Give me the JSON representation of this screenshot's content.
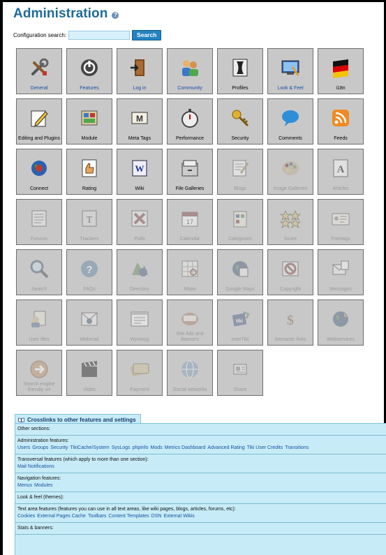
{
  "page": {
    "title": "Administration",
    "search_label": "Configuration search:",
    "search_value": "",
    "search_button": "Search"
  },
  "features": [
    {
      "label": "General",
      "icon": "tools-icon",
      "enabled": true,
      "link": true
    },
    {
      "label": "Features",
      "icon": "power-icon",
      "enabled": true,
      "link": true
    },
    {
      "label": "Log in",
      "icon": "login-door-icon",
      "enabled": true,
      "link": true
    },
    {
      "label": "Community",
      "icon": "community-icon",
      "enabled": true,
      "link": true
    },
    {
      "label": "Profiles",
      "icon": "profiles-icon",
      "enabled": true,
      "link": false
    },
    {
      "label": "Look & Feel",
      "icon": "look-feel-icon",
      "enabled": true,
      "link": true
    },
    {
      "label": "i18n",
      "icon": "flag-icon",
      "enabled": true,
      "link": false
    },
    {
      "label": "Editing and Plugins",
      "icon": "edit-pencil-icon",
      "enabled": true,
      "link": false
    },
    {
      "label": "Module",
      "icon": "module-icon",
      "enabled": true,
      "link": false
    },
    {
      "label": "Meta Tags",
      "icon": "meta-tags-icon",
      "enabled": true,
      "link": false
    },
    {
      "label": "Performance",
      "icon": "stopwatch-icon",
      "enabled": true,
      "link": false
    },
    {
      "label": "Security",
      "icon": "key-icon",
      "enabled": true,
      "link": false
    },
    {
      "label": "Comments",
      "icon": "comment-bubble-icon",
      "enabled": true,
      "link": false
    },
    {
      "label": "Feeds",
      "icon": "rss-icon",
      "enabled": true,
      "link": false
    },
    {
      "label": "Connect",
      "icon": "connect-globe-icon",
      "enabled": true,
      "link": false
    },
    {
      "label": "Rating",
      "icon": "rating-thumb-icon",
      "enabled": true,
      "link": false
    },
    {
      "label": "Wiki",
      "icon": "wiki-icon",
      "enabled": true,
      "link": false
    },
    {
      "label": "File Galleries",
      "icon": "file-cabinet-icon",
      "enabled": true,
      "link": false
    },
    {
      "label": "Blogs",
      "icon": "blog-icon",
      "enabled": false,
      "link": false
    },
    {
      "label": "Image Galleries",
      "icon": "palette-icon",
      "enabled": false,
      "link": false
    },
    {
      "label": "Articles",
      "icon": "articles-icon",
      "enabled": false,
      "link": false
    },
    {
      "label": "Forums",
      "icon": "forums-icon",
      "enabled": false,
      "link": false
    },
    {
      "label": "Trackers",
      "icon": "trackers-icon",
      "enabled": false,
      "link": false
    },
    {
      "label": "Polls",
      "icon": "polls-icon",
      "enabled": false,
      "link": false
    },
    {
      "label": "Calendar",
      "icon": "calendar-icon",
      "enabled": false,
      "link": false
    },
    {
      "label": "Categories",
      "icon": "categories-icon",
      "enabled": false,
      "link": false
    },
    {
      "label": "Score",
      "icon": "stars-icon",
      "enabled": false,
      "link": false
    },
    {
      "label": "Freetags",
      "icon": "freetags-icon",
      "enabled": false,
      "link": false
    },
    {
      "label": "Search",
      "icon": "magnifier-icon",
      "enabled": false,
      "link": false
    },
    {
      "label": "FAQs",
      "icon": "faq-icon",
      "enabled": false,
      "link": false
    },
    {
      "label": "Directory",
      "icon": "directory-icon",
      "enabled": false,
      "link": false
    },
    {
      "label": "Maps",
      "icon": "maps-icon",
      "enabled": false,
      "link": false
    },
    {
      "label": "Google Maps",
      "icon": "google-maps-icon",
      "enabled": false,
      "link": false
    },
    {
      "label": "Copyright",
      "icon": "copyright-icon",
      "enabled": false,
      "link": false
    },
    {
      "label": "Messages",
      "icon": "messages-icon",
      "enabled": false,
      "link": false
    },
    {
      "label": "User files",
      "icon": "user-files-icon",
      "enabled": false,
      "link": false
    },
    {
      "label": "Webmail",
      "icon": "webmail-icon",
      "enabled": false,
      "link": false
    },
    {
      "label": "Wysiwyg",
      "icon": "wysiwyg-icon",
      "enabled": false,
      "link": false
    },
    {
      "label": "Site Ads and Banners",
      "icon": "site-ads-icon",
      "enabled": false,
      "link": false
    },
    {
      "label": "InterTiki",
      "icon": "intertiki-icon",
      "enabled": false,
      "link": false
    },
    {
      "label": "Semantic links",
      "icon": "semantic-links-icon",
      "enabled": false,
      "link": false
    },
    {
      "label": "Webservices",
      "icon": "webservices-icon",
      "enabled": false,
      "link": false
    },
    {
      "label": "Search engine friendly url",
      "icon": "sefurl-icon",
      "enabled": false,
      "link": false
    },
    {
      "label": "Video",
      "icon": "video-clapper-icon",
      "enabled": false,
      "link": false
    },
    {
      "label": "Payment",
      "icon": "payment-card-icon",
      "enabled": false,
      "link": false
    },
    {
      "label": "Social networks",
      "icon": "social-globe-icon",
      "enabled": false,
      "link": false
    },
    {
      "label": "Share",
      "icon": "share-icon",
      "enabled": false,
      "link": false
    }
  ],
  "crosslinks": {
    "heading": "Crosslinks to other features and settings",
    "sections": [
      {
        "title": "Other sections:",
        "links": []
      },
      {
        "title": "Administration features:",
        "links": [
          "Users",
          "Groups",
          "Security",
          "TikiCache/System",
          "SysLogs",
          "phpinfo",
          "Mods",
          "Metrics Dashboard",
          "Advanced Rating",
          "Tiki User Credits",
          "Transitions"
        ]
      },
      {
        "title": "Transversal features (which apply to more than one section):",
        "links": [
          "Mail Notifications"
        ]
      },
      {
        "title": "Navigation features:",
        "links": [
          "Menus",
          "Modules"
        ]
      },
      {
        "title": "Look & feel (themes):",
        "links": []
      },
      {
        "title": "Text area features (features you can use in all text areas, like wiki pages, blogs, articles, forums, etc):",
        "links": [
          "Cookies",
          "External Pages Cache",
          "Toolbars",
          "Content Templates",
          "DSN",
          "External Wikis"
        ]
      },
      {
        "title": "Stats & banners:",
        "links": []
      }
    ]
  },
  "colors": {
    "title": "#1e6c97",
    "tile_bg": "#c8c8c8",
    "link": "#1a4fa3",
    "panel_bg": "#c7ecf7",
    "button_bg": "#2383c2"
  }
}
